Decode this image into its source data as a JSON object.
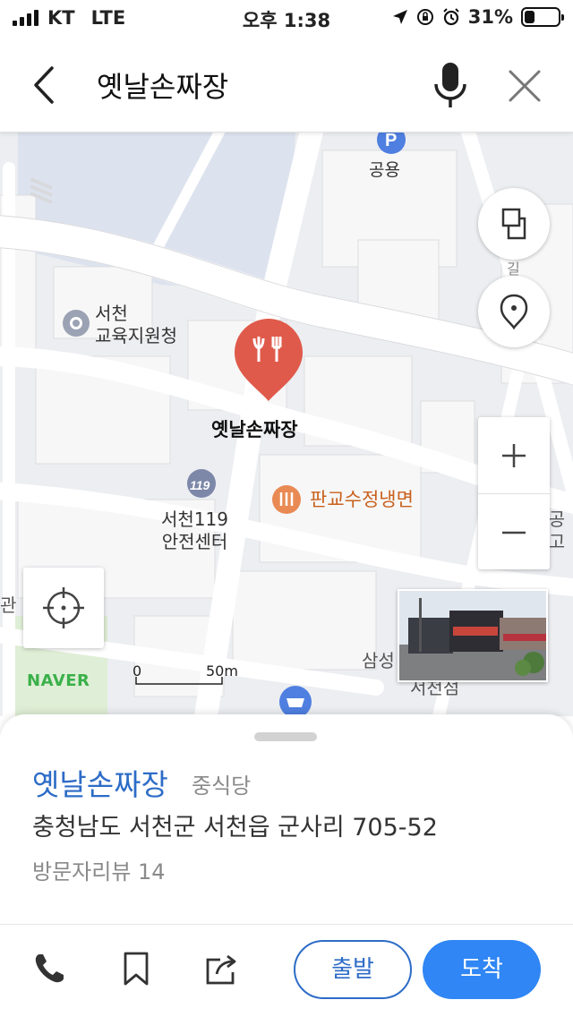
{
  "status_bar": {
    "carrier": "KT",
    "network": "LTE",
    "time": "오후 1:38",
    "battery_percent_label": "31%",
    "battery_level": 0.31
  },
  "search": {
    "query": "옛날손짜장"
  },
  "map": {
    "labels": {
      "parking": "공용",
      "edu_office": "서천\n교육지원청",
      "selected_place": "옛날손짜장",
      "nearby_restaurant": "판교수정냉면",
      "fire_station": "서천119\n안전센터",
      "samsung": "삼성",
      "samsung_sub": "서천점",
      "road_partial": "길",
      "edge_right": "공고",
      "edge_left": "관"
    },
    "scale": {
      "start": "0",
      "end": "50m"
    },
    "watermark": "NAVER"
  },
  "place": {
    "name": "옛날손짜장",
    "category": "중식당",
    "address": "충청남도 서천군 서천읍 군사리 705-52",
    "reviews": "방문자리뷰 14"
  },
  "actions": {
    "start_label": "출발",
    "arrive_label": "도착"
  },
  "colors": {
    "accent": "#2d6cc7",
    "arrive_button": "#2f86f4",
    "pin": "#e05a4b",
    "restaurant_label": "#c9601c"
  }
}
